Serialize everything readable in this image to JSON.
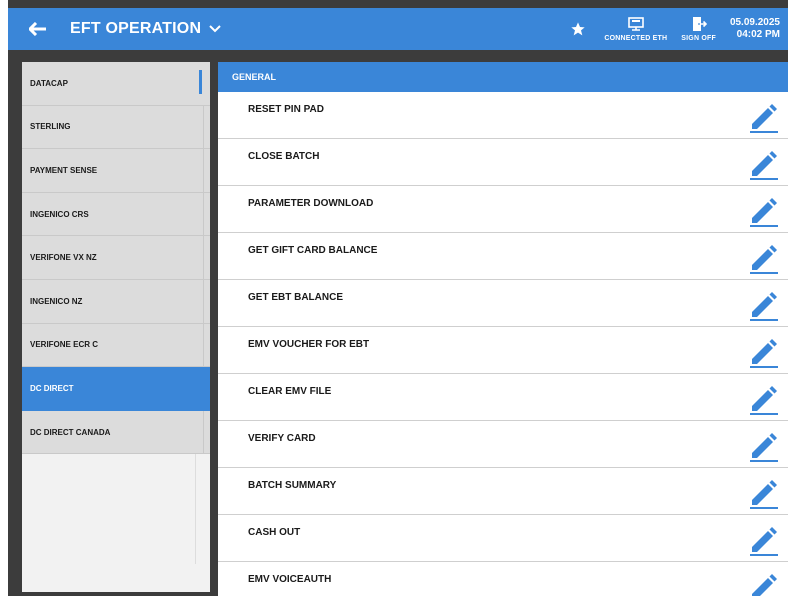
{
  "header": {
    "title": "EFT OPERATION",
    "connected_label": "CONNECTED ETH",
    "signoff_label": "SIGN OFF",
    "date": "05.09.2025",
    "time": "04:02 PM",
    "icons": {
      "back": "back-arrow-icon",
      "dropdown": "chevron-down-icon",
      "favorite": "star-icon",
      "connection": "network-icon",
      "signoff": "exit-door-icon"
    }
  },
  "sidebar": {
    "items": [
      {
        "label": "DATACAP"
      },
      {
        "label": "STERLING"
      },
      {
        "label": "PAYMENT SENSE"
      },
      {
        "label": "INGENICO CRS"
      },
      {
        "label": "VERIFONE VX NZ"
      },
      {
        "label": "INGENICO NZ"
      },
      {
        "label": "VERIFONE ECR C"
      },
      {
        "label": "DC DIRECT"
      },
      {
        "label": "DC DIRECT CANADA"
      }
    ],
    "selected_index": 7
  },
  "main": {
    "section_title": "GENERAL",
    "operations": [
      {
        "label": "RESET PIN PAD"
      },
      {
        "label": "CLOSE BATCH"
      },
      {
        "label": "PARAMETER DOWNLOAD"
      },
      {
        "label": "GET GIFT CARD BALANCE"
      },
      {
        "label": "GET EBT BALANCE"
      },
      {
        "label": "EMV VOUCHER FOR EBT"
      },
      {
        "label": "CLEAR EMV FILE"
      },
      {
        "label": "VERIFY CARD"
      },
      {
        "label": "BATCH SUMMARY"
      },
      {
        "label": "CASH OUT"
      },
      {
        "label": "EMV VOICEAUTH"
      }
    ],
    "edit_icon": "pencil-icon"
  },
  "colors": {
    "accent": "#3a86d8",
    "frame": "#3c3c3c",
    "sidebar_bg": "#dcdcdc"
  }
}
